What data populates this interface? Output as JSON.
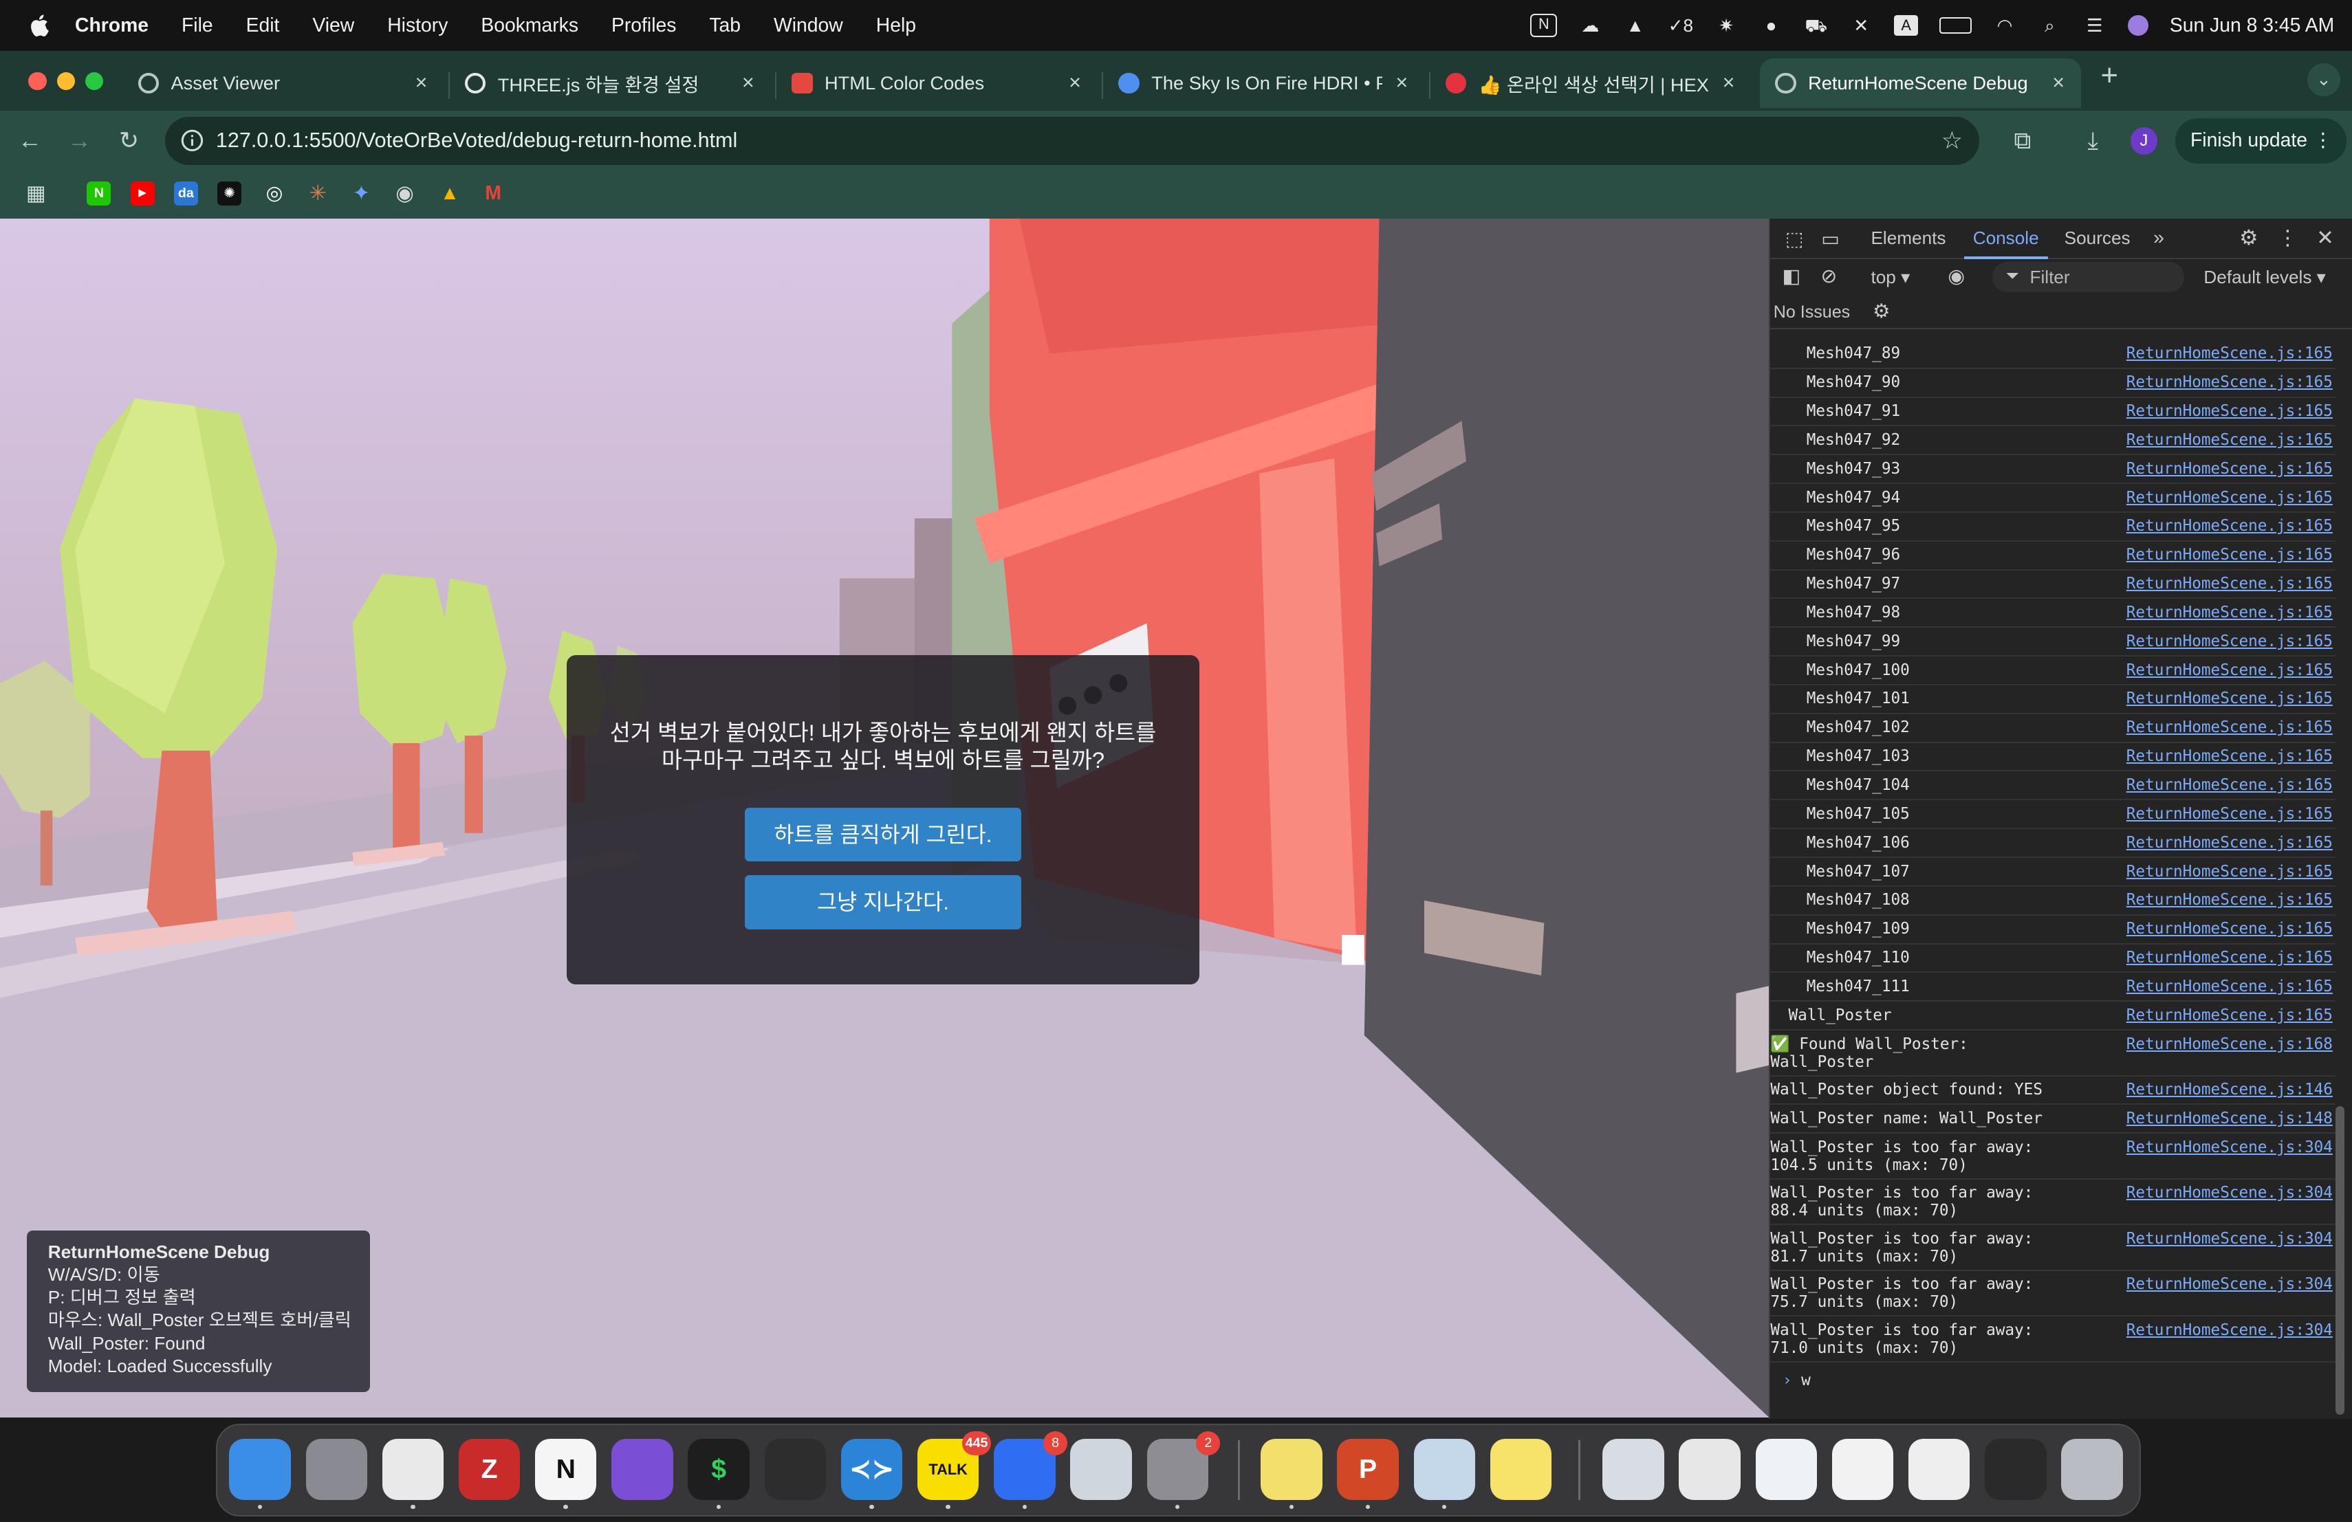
{
  "menubar": {
    "items": [
      "Chrome",
      "File",
      "Edit",
      "View",
      "History",
      "Bookmarks",
      "Profiles",
      "Tab",
      "Window",
      "Help"
    ],
    "clock": "Sun Jun 8  3:45 AM",
    "badge_count": "8"
  },
  "tabs": [
    {
      "title": "Asset Viewer",
      "icon_color": "#b9c8c3"
    },
    {
      "title": "THREE.js 하늘 환경 설정",
      "icon_color": "#e6e6e6"
    },
    {
      "title": "HTML Color Codes",
      "icon_color": "#e5483f"
    },
    {
      "title": "The Sky Is On Fire HDRI • Pol",
      "icon_color": "#4f8ff0"
    },
    {
      "title": "👍 온라인 색상 선택기 | HEX 색상",
      "icon_color": "#e4323e"
    },
    {
      "title": "ReturnHomeScene Debug",
      "icon_color": "#b9c8c3"
    }
  ],
  "toolbar": {
    "url": "127.0.0.1:5500/VoteOrBeVoted/debug-return-home.html",
    "finish_update": "Finish update",
    "avatar_letter": "J"
  },
  "bookmarks": [
    "N",
    "▶",
    "da",
    "✺",
    "◎",
    "✳",
    "✦",
    "◉",
    "▲",
    "M"
  ],
  "dialog": {
    "message": "선거 벽보가 붙어있다! 내가 좋아하는 후보에게 왠지 하트를 마구마구 그려주고 싶다. 벽보에 하트를 그릴까?",
    "choice1": "하트를 큼직하게 그린다.",
    "choice2": "그냥 지나간다."
  },
  "debug": {
    "title": "ReturnHomeScene Debug",
    "lines": [
      "W/A/S/D: 이동",
      "P: 디버그 정보 출력",
      "마우스: Wall_Poster 오브젝트 호버/클릭",
      "Wall_Poster: Found",
      "Model: Loaded Successfully"
    ]
  },
  "devtools": {
    "tabs": [
      "Elements",
      "Console",
      "Sources"
    ],
    "context": "top ▾",
    "filter_placeholder": "Filter",
    "levels": "Default levels ▾",
    "issues": "No Issues",
    "prompt_input": "w",
    "logs": [
      {
        "text": "    Mesh047_89",
        "src": "ReturnHomeScene.js:165"
      },
      {
        "text": "    Mesh047_90",
        "src": "ReturnHomeScene.js:165"
      },
      {
        "text": "    Mesh047_91",
        "src": "ReturnHomeScene.js:165"
      },
      {
        "text": "    Mesh047_92",
        "src": "ReturnHomeScene.js:165"
      },
      {
        "text": "    Mesh047_93",
        "src": "ReturnHomeScene.js:165"
      },
      {
        "text": "    Mesh047_94",
        "src": "ReturnHomeScene.js:165"
      },
      {
        "text": "    Mesh047_95",
        "src": "ReturnHomeScene.js:165"
      },
      {
        "text": "    Mesh047_96",
        "src": "ReturnHomeScene.js:165"
      },
      {
        "text": "    Mesh047_97",
        "src": "ReturnHomeScene.js:165"
      },
      {
        "text": "    Mesh047_98",
        "src": "ReturnHomeScene.js:165"
      },
      {
        "text": "    Mesh047_99",
        "src": "ReturnHomeScene.js:165"
      },
      {
        "text": "    Mesh047_100",
        "src": "ReturnHomeScene.js:165"
      },
      {
        "text": "    Mesh047_101",
        "src": "ReturnHomeScene.js:165"
      },
      {
        "text": "    Mesh047_102",
        "src": "ReturnHomeScene.js:165"
      },
      {
        "text": "    Mesh047_103",
        "src": "ReturnHomeScene.js:165"
      },
      {
        "text": "    Mesh047_104",
        "src": "ReturnHomeScene.js:165"
      },
      {
        "text": "    Mesh047_105",
        "src": "ReturnHomeScene.js:165"
      },
      {
        "text": "    Mesh047_106",
        "src": "ReturnHomeScene.js:165"
      },
      {
        "text": "    Mesh047_107",
        "src": "ReturnHomeScene.js:165"
      },
      {
        "text": "    Mesh047_108",
        "src": "ReturnHomeScene.js:165"
      },
      {
        "text": "    Mesh047_109",
        "src": "ReturnHomeScene.js:165"
      },
      {
        "text": "    Mesh047_110",
        "src": "ReturnHomeScene.js:165"
      },
      {
        "text": "    Mesh047_111",
        "src": "ReturnHomeScene.js:165"
      },
      {
        "text": "  Wall_Poster",
        "src": "ReturnHomeScene.js:165"
      },
      {
        "text": "✅ Found Wall_Poster:\nWall_Poster",
        "src": "ReturnHomeScene.js:168"
      },
      {
        "text": "Wall_Poster object found: YES",
        "src": "ReturnHomeScene.js:146"
      },
      {
        "text": "Wall_Poster name: Wall_Poster",
        "src": "ReturnHomeScene.js:148"
      },
      {
        "text": "Wall_Poster is too far away:\n104.5 units (max: 70)",
        "src": "ReturnHomeScene.js:304"
      },
      {
        "text": "Wall_Poster is too far away:\n88.4 units (max: 70)",
        "src": "ReturnHomeScene.js:304"
      },
      {
        "text": "Wall_Poster is too far away:\n81.7 units (max: 70)",
        "src": "ReturnHomeScene.js:304"
      },
      {
        "text": "Wall_Poster is too far away:\n75.7 units (max: 70)",
        "src": "ReturnHomeScene.js:304"
      },
      {
        "text": "Wall_Poster is too far away:\n71.0 units (max: 70)",
        "src": "ReturnHomeScene.js:304"
      }
    ]
  },
  "dock": {
    "apps": [
      {
        "name": "finder",
        "color": "#3a8ee6",
        "badge": ""
      },
      {
        "name": "launchpad",
        "color": "#8a8a93",
        "badge": ""
      },
      {
        "name": "chrome",
        "color": "#e9e9e9",
        "badge": ""
      },
      {
        "name": "zotero",
        "color": "#c92a2a",
        "badge": ""
      },
      {
        "name": "notion",
        "color": "#f5f5f5",
        "badge": ""
      },
      {
        "name": "obsidian",
        "color": "#7a4fd6",
        "badge": ""
      },
      {
        "name": "terminal",
        "color": "#1e1e1e",
        "badge": ""
      },
      {
        "name": "unity",
        "color": "#2d2d2d",
        "badge": ""
      },
      {
        "name": "vscode",
        "color": "#2c84d8",
        "badge": ""
      },
      {
        "name": "kakaotalk",
        "color": "#f8df00",
        "badge": "445"
      },
      {
        "name": "ticktick",
        "color": "#2f6ef0",
        "badge": "8"
      },
      {
        "name": "simulator",
        "color": "#d0d6de",
        "badge": ""
      },
      {
        "name": "system-settings",
        "color": "#8d8d93",
        "badge": "2"
      },
      {
        "name": "stickies",
        "color": "#f3df6b",
        "badge": ""
      },
      {
        "name": "powerpoint",
        "color": "#d24726",
        "badge": ""
      },
      {
        "name": "preview",
        "color": "#c4d8ea",
        "badge": ""
      },
      {
        "name": "notes",
        "color": "#f7e26a",
        "badge": ""
      },
      {
        "name": "recent-1",
        "color": "#d7dde3",
        "badge": ""
      },
      {
        "name": "recent-2",
        "color": "#e7e7e7",
        "badge": ""
      },
      {
        "name": "recent-3",
        "color": "#eef1f5",
        "badge": ""
      },
      {
        "name": "recent-4",
        "color": "#f2f2f2",
        "badge": ""
      },
      {
        "name": "recent-5",
        "color": "#eeeeee",
        "badge": ""
      },
      {
        "name": "recent-6",
        "color": "#2a2a2a",
        "badge": ""
      },
      {
        "name": "trash",
        "color": "#b9bcc2",
        "badge": ""
      }
    ]
  }
}
